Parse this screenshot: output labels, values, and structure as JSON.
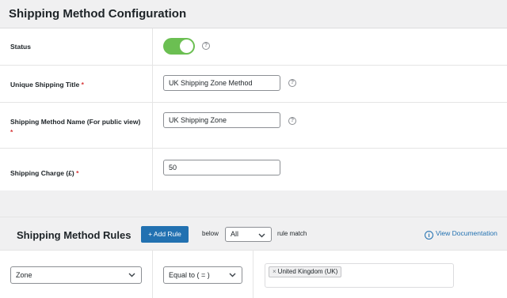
{
  "header": {
    "title": "Shipping Method Configuration"
  },
  "form": {
    "status": {
      "label": "Status",
      "enabled": true,
      "help": "?"
    },
    "unique_title": {
      "label": "Unique Shipping Title",
      "required": "*",
      "value": "UK Shipping Zone Method",
      "help": "?"
    },
    "method_name": {
      "label": "Shipping Method Name (For public view)",
      "required": "*",
      "value": "UK Shipping Zone",
      "help": "?"
    },
    "shipping_charge": {
      "label": "Shipping Charge (£)",
      "required": "*",
      "value": "50"
    }
  },
  "rules": {
    "title": "Shipping Method Rules",
    "add_button": "+ Add Rule",
    "below_label": "below",
    "match_value": "All",
    "rule_match_label": "rule match",
    "doc_icon": "info-icon",
    "doc_link": "View Documentation",
    "row": {
      "condition": "Zone",
      "operator": "Equal to ( = )",
      "tag_remove": "×",
      "tag": "United Kingdom (UK)"
    }
  },
  "colors": {
    "toggle_on": "#6bbf52",
    "button": "#2271b1",
    "link": "#2271b1",
    "required": "#d63638"
  }
}
